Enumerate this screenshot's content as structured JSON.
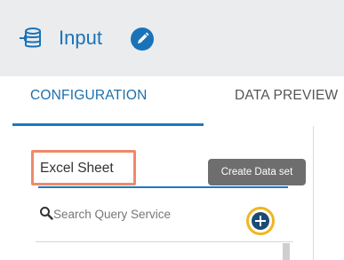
{
  "header": {
    "title": "Input",
    "icon": "database-input-icon",
    "edit_icon": "pencil-edit-icon",
    "accent_color": "#1a73b8"
  },
  "tabs": [
    {
      "label": "CONFIGURATION",
      "active": true
    },
    {
      "label": "DATA PREVIEW",
      "active": false
    }
  ],
  "form": {
    "dataset_name": "Excel Sheet",
    "tooltip": "Create Data set",
    "search_placeholder": "Search Query Service",
    "add_icon": "plus-circle-icon",
    "highlight_color": "#ee8a6a",
    "add_highlight_color": "#f0b620"
  }
}
